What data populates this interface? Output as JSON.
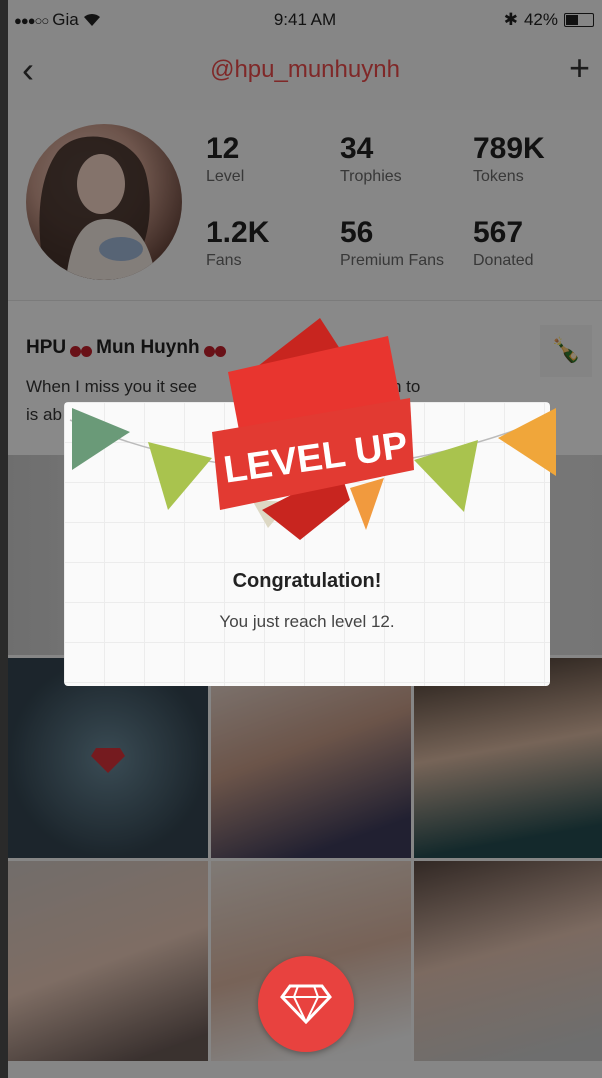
{
  "status_bar": {
    "signal": "●●●○○",
    "carrier": "Gia",
    "time": "9:41 AM",
    "bluetooth": "✱",
    "battery": "42%",
    "battery_level": 0.42
  },
  "nav": {
    "back_icon": "chevron-left-icon",
    "title": "@hpu_munhuynh",
    "add_icon": "plus-icon"
  },
  "profile": {
    "stats": [
      {
        "value": "12",
        "label": "Level"
      },
      {
        "value": "34",
        "label": "Trophies"
      },
      {
        "value": "789K",
        "label": "Tokens"
      },
      {
        "value": "1.2K",
        "label": "Fans"
      },
      {
        "value": "56",
        "label": "Premium Fans"
      },
      {
        "value": "567",
        "label": "Donated"
      }
    ]
  },
  "bio": {
    "name_part1": "HPU",
    "name_part2": "Mun Huynh",
    "text_line1": "When I miss you it see",
    "text_line1b": "listen to",
    "text_line2": "is ab"
  },
  "modal": {
    "banner_text": "LEVEL UP",
    "heading": "Congratulation!",
    "message": "You just reach level 12."
  },
  "colors": {
    "accent": "#e84a4a",
    "banner_red": "#e8352f",
    "fab": "#e8423f"
  }
}
